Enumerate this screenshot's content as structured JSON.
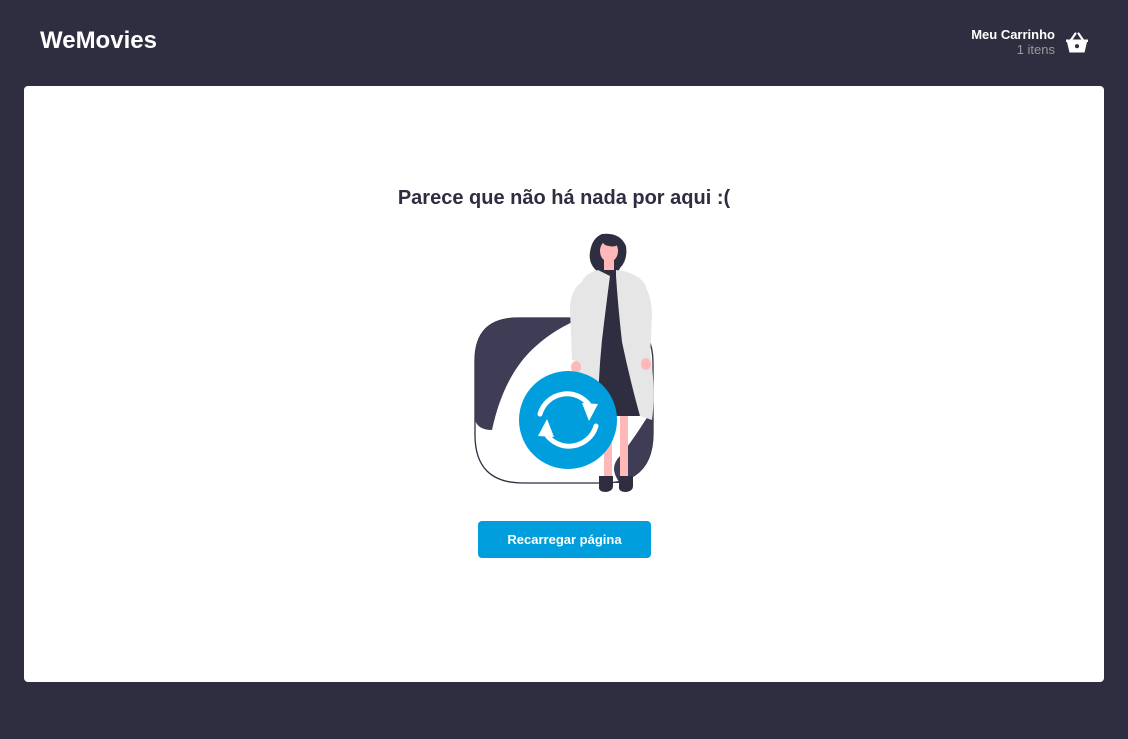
{
  "header": {
    "logo": "WeMovies",
    "cart": {
      "title": "Meu Carrinho",
      "count_label": "1 itens",
      "icon": "basket-icon"
    }
  },
  "main": {
    "empty_message": "Parece que não há nada por aqui :(",
    "illustration": {
      "icon": "reload-icon"
    },
    "reload_button_label": "Recarregar página"
  },
  "colors": {
    "background": "#2f2e41",
    "card": "#ffffff",
    "accent": "#009edd",
    "text_dark": "#2f2e41",
    "text_muted": "#999999"
  }
}
